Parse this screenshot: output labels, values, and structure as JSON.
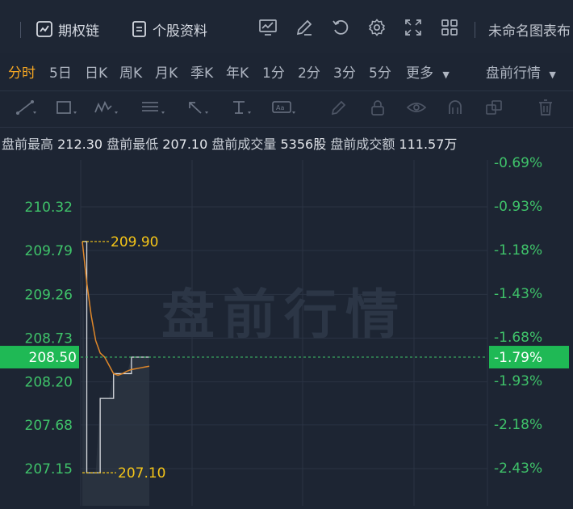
{
  "toolbar": {
    "options_chain": "期权链",
    "stock_profile": "个股资料",
    "chart_name": "未命名图表布"
  },
  "periods": [
    "分时",
    "5日",
    "日K",
    "周K",
    "月K",
    "季K",
    "年K",
    "1分",
    "2分",
    "3分",
    "5分",
    "更多"
  ],
  "active_period": "分时",
  "session_select": "盘前行情",
  "info": {
    "high_label": "盘前最高",
    "high": "212.30",
    "low_label": "盘前最低",
    "low": "207.10",
    "vol_label": "盘前成交量",
    "vol": "5356股",
    "amt_label": "盘前成交额",
    "amt": "111.57万"
  },
  "watermark": "盘前行情",
  "colors": {
    "accent": "#f5a623",
    "green": "#1fb955",
    "price_line": "#e0882a",
    "avg_line": "#d8dbe0",
    "label_yellow": "#f5c518"
  },
  "chart_data": {
    "type": "line",
    "y_left_ticks": [
      "210.32",
      "209.79",
      "209.26",
      "208.73",
      "208.20",
      "207.68",
      "207.15"
    ],
    "y_right_ticks": [
      "-0.69%",
      "-0.93%",
      "-1.18%",
      "-1.43%",
      "-1.68%",
      "-1.93%",
      "-2.18%",
      "-2.43%"
    ],
    "y_left_range": [
      207.15,
      210.32
    ],
    "current_price": "208.50",
    "current_pct": "-1.79%",
    "high_marker": "209.90",
    "low_marker": "207.10",
    "price_series": [
      209.9,
      209.4,
      209.0,
      208.7,
      208.55,
      208.5,
      208.4,
      208.3,
      208.28,
      208.3,
      208.33,
      208.35,
      208.36,
      208.37,
      208.38,
      208.39
    ],
    "avg_series": [
      209.9,
      207.1,
      207.1,
      207.1,
      208.0,
      208.0,
      208.0,
      208.3,
      208.3,
      208.3,
      208.3,
      208.5,
      208.5,
      208.5,
      208.5,
      208.5
    ]
  }
}
